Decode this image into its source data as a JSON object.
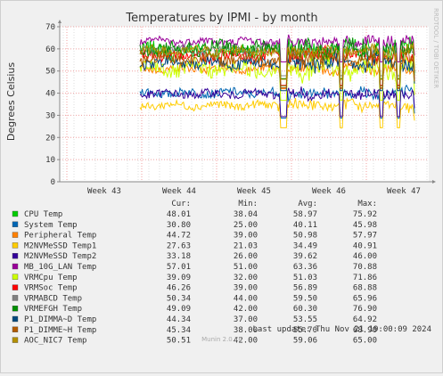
{
  "chart_data": {
    "type": "line",
    "title": "Temperatures by IPMI - by month",
    "ylabel": "Degrees Celsius",
    "side_label": "RRDTOOL / TOBI OETIKER",
    "footer": "Munin 2.0.76",
    "last_update": "Last update: Thu Nov 21 19:00:09 2024",
    "ylim": [
      0,
      70
    ],
    "yticks": [
      "0",
      "10",
      "20",
      "30",
      "40",
      "50",
      "60",
      "70"
    ],
    "xticks": [
      "Week 43",
      "Week 44",
      "Week 45",
      "Week 46",
      "Week 47"
    ],
    "grid": true,
    "legend_headers": [
      "Cur:",
      "Min:",
      "Avg:",
      "Max:"
    ],
    "series": [
      {
        "name": "CPU Temp",
        "color": "#00cc00",
        "cur": "48.01",
        "min": "38.04",
        "avg": "58.97",
        "max": "75.92"
      },
      {
        "name": "System Temp",
        "color": "#0066b3",
        "cur": "30.80",
        "min": "25.00",
        "avg": "40.11",
        "max": "45.98"
      },
      {
        "name": "Peripheral Temp",
        "color": "#ff8000",
        "cur": "44.72",
        "min": "39.00",
        "avg": "50.98",
        "max": "57.97"
      },
      {
        "name": "M2NVMeSSD Temp1",
        "color": "#ffcc00",
        "cur": "27.63",
        "min": "21.03",
        "avg": "34.49",
        "max": "40.91"
      },
      {
        "name": "M2NVMeSSD Temp2",
        "color": "#330099",
        "cur": "33.18",
        "min": "26.00",
        "avg": "39.62",
        "max": "46.00"
      },
      {
        "name": "MB_10G_LAN Temp",
        "color": "#990099",
        "cur": "57.01",
        "min": "51.00",
        "avg": "63.36",
        "max": "70.88"
      },
      {
        "name": "VRMCpu Temp",
        "color": "#ccff00",
        "cur": "39.09",
        "min": "32.00",
        "avg": "51.03",
        "max": "71.86"
      },
      {
        "name": "VRMSoc Temp",
        "color": "#ff0000",
        "cur": "46.26",
        "min": "39.00",
        "avg": "56.89",
        "max": "68.88"
      },
      {
        "name": "VRMABCD Temp",
        "color": "#808080",
        "cur": "50.34",
        "min": "44.00",
        "avg": "59.50",
        "max": "65.96"
      },
      {
        "name": "VRMEFGH Temp",
        "color": "#008f00",
        "cur": "49.09",
        "min": "42.00",
        "avg": "60.30",
        "max": "76.90"
      },
      {
        "name": "P1_DIMMA~D Temp",
        "color": "#00487d",
        "cur": "44.34",
        "min": "37.00",
        "avg": "53.55",
        "max": "64.92"
      },
      {
        "name": "P1_DIMME~H Temp",
        "color": "#b35a00",
        "cur": "45.34",
        "min": "38.00",
        "avg": "55.70",
        "max": "68.90"
      },
      {
        "name": "AOC_NIC7 Temp",
        "color": "#b38f00",
        "cur": "50.51",
        "min": "42.00",
        "avg": "59.06",
        "max": "65.00"
      }
    ]
  }
}
